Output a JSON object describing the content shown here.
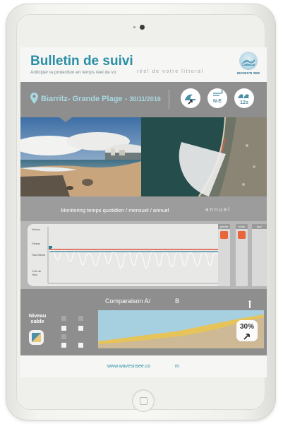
{
  "header": {
    "title": "Bulletin de suivi",
    "subtitle": "Anticiper la protection en temps réel de vo",
    "subtitle_tail": "réel de votre littoral",
    "logo_text": "WAVES'N SEE"
  },
  "location": {
    "place": "Biarritz- Grande Plage -",
    "date": "30/11/2016",
    "icons": [
      {
        "name": "wave-icon",
        "label": ""
      },
      {
        "name": "wind-icon",
        "label": "N-E"
      },
      {
        "name": "period-icon",
        "label": "12s"
      }
    ]
  },
  "monitoring": {
    "label": "Monitoring temps quotidien / mensuel / annuel",
    "active": "annuel",
    "legend": [
      "Niveau",
      "Falaise",
      "Haut littoral",
      "Cote de l'eau"
    ],
    "tabs": [
      "janvier",
      "mois",
      "jour"
    ],
    "colors": {
      "line_red": "#e0543a",
      "line_blue": "#4f8fa8",
      "accent": "#2a8fa6"
    }
  },
  "comparison": {
    "title": "Comparaison A/",
    "title_b": "B",
    "niveau_label": "Niveau sable",
    "percent": "30%"
  },
  "footer": {
    "url": "www.wavesnsee.co",
    "url_tail": "m"
  }
}
